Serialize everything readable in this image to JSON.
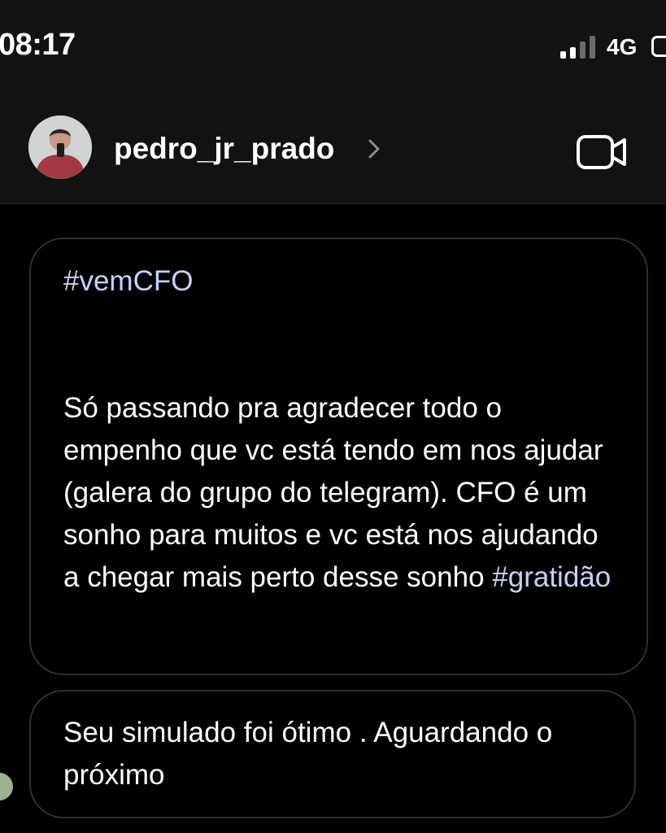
{
  "status_bar": {
    "time": "08:17",
    "network": "4G",
    "signal_bars_filled": 2,
    "signal_bars_total": 4
  },
  "header": {
    "username": "pedro_jr_prado"
  },
  "messages": [
    {
      "hashtag_top": "#vemCFO",
      "body": "Só passando pra agradecer todo o empenho que vc está tendo em nos ajudar (galera do grupo do telegram). CFO é um sonho para muitos e vc está nos ajudando a chegar mais perto desse sonho ",
      "hashtag_end": "#gratidão"
    },
    {
      "body": "Seu simulado foi ótimo . Aguardando o próximo"
    }
  ],
  "colors": {
    "background": "#000000",
    "header": "#121212",
    "bubble_border": "#2f2f2f",
    "hashtag": "#c7d1f8",
    "text": "#ffffff"
  },
  "icons": [
    "signal-icon",
    "battery-icon",
    "avatar",
    "chevron-right-icon",
    "video-call-icon"
  ]
}
